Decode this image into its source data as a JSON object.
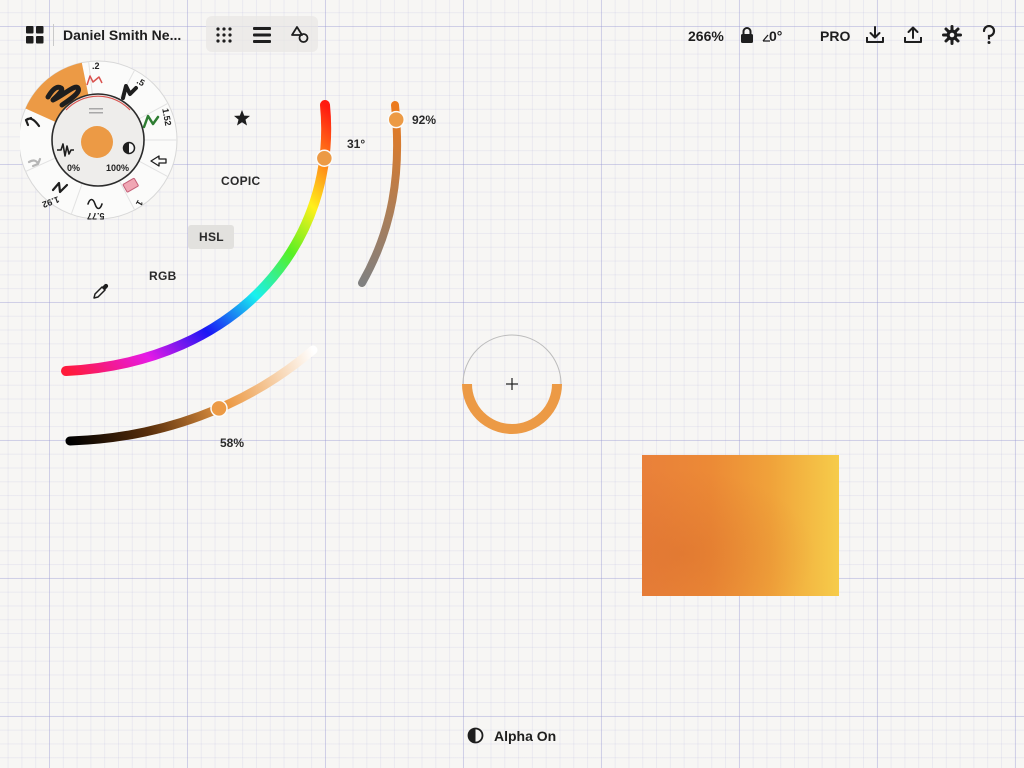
{
  "toolbar": {
    "doc_title": "Daniel Smith Ne...",
    "zoom": "266%",
    "rotation": "0°",
    "pro_label": "PRO",
    "icons": [
      "gallery-icon",
      "grid-dots-icon",
      "layers-icon",
      "shapes-icon",
      "lock-icon",
      "download-icon",
      "share-icon",
      "gear-icon",
      "help-icon"
    ]
  },
  "brush_wheel": {
    "sizes": [
      ".2",
      ".5",
      "1.52",
      "1",
      "5.77",
      "1.92"
    ],
    "opacity_label": "0%",
    "contrast_label": "100%",
    "current_color": "#ec9a45"
  },
  "color_picker": {
    "modes": {
      "copic": "COPIC",
      "hsl": "HSL",
      "rgb": "RGB"
    },
    "selected_mode": "HSL",
    "hue_label": "31°",
    "saturation_label": "92%",
    "lightness_label": "58%",
    "hue_deg": 31,
    "saturation_pct": 92,
    "lightness_pct": 58
  },
  "bottom_bar": {
    "alpha_label": "Alpha On"
  },
  "colors": {
    "accent": "#ec9a45",
    "swatch_start": "#e9803a",
    "swatch_end": "#f6cc4a"
  }
}
